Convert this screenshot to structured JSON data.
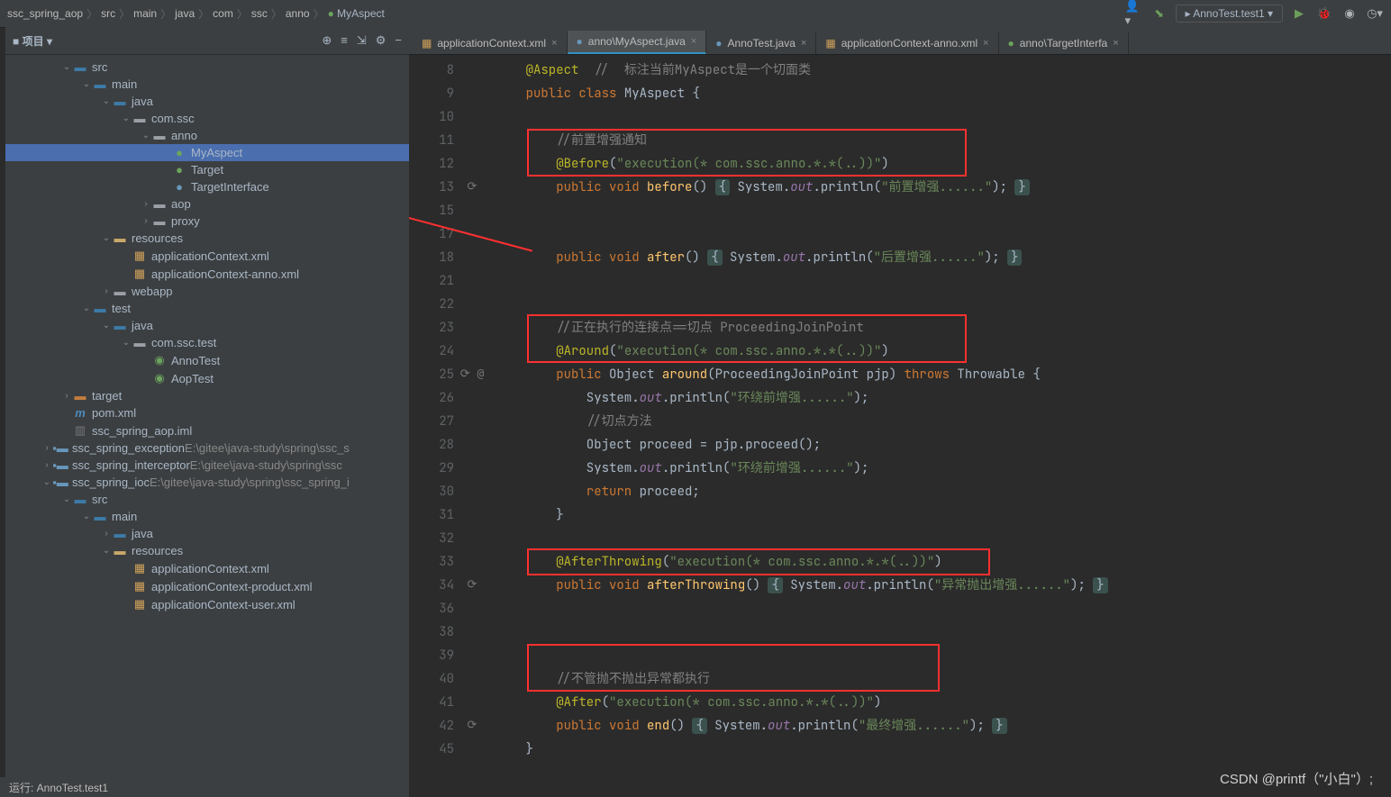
{
  "breadcrumb": [
    "ssc_spring_aop",
    "src",
    "main",
    "java",
    "com",
    "ssc",
    "anno",
    "MyAspect"
  ],
  "run_config": "AnnoTest.test1",
  "project": {
    "title": "项目"
  },
  "tree": [
    {
      "d": 0,
      "a": "v",
      "i": "fs",
      "t": "src"
    },
    {
      "d": 1,
      "a": "v",
      "i": "fs",
      "t": "main"
    },
    {
      "d": 2,
      "a": "v",
      "i": "fs",
      "t": "java"
    },
    {
      "d": 3,
      "a": "v",
      "i": "fp",
      "t": "com.ssc"
    },
    {
      "d": 4,
      "a": "v",
      "i": "fp",
      "t": "anno"
    },
    {
      "d": 5,
      "a": "",
      "i": "c",
      "t": "MyAspect",
      "sel": true
    },
    {
      "d": 5,
      "a": "",
      "i": "c",
      "t": "Target"
    },
    {
      "d": 5,
      "a": "",
      "i": "if",
      "t": "TargetInterface"
    },
    {
      "d": 4,
      "a": ">",
      "i": "fp",
      "t": "aop"
    },
    {
      "d": 4,
      "a": ">",
      "i": "fp",
      "t": "proxy"
    },
    {
      "d": 2,
      "a": "v",
      "i": "fr",
      "t": "resources"
    },
    {
      "d": 3,
      "a": "",
      "i": "x",
      "t": "applicationContext.xml"
    },
    {
      "d": 3,
      "a": "",
      "i": "x",
      "t": "applicationContext-anno.xml"
    },
    {
      "d": 2,
      "a": ">",
      "i": "fw",
      "t": "webapp"
    },
    {
      "d": 1,
      "a": "v",
      "i": "fs",
      "t": "test"
    },
    {
      "d": 2,
      "a": "v",
      "i": "fs",
      "t": "java"
    },
    {
      "d": 3,
      "a": "v",
      "i": "fp",
      "t": "com.ssc.test"
    },
    {
      "d": 4,
      "a": "",
      "i": "ct",
      "t": "AnnoTest"
    },
    {
      "d": 4,
      "a": "",
      "i": "ct",
      "t": "AopTest"
    },
    {
      "d": 0,
      "a": ">",
      "i": "ft",
      "t": "target"
    },
    {
      "d": 0,
      "a": "",
      "i": "m",
      "t": "pom.xml"
    },
    {
      "d": 0,
      "a": "",
      "i": "iml",
      "t": "ssc_spring_aop.iml"
    },
    {
      "d": -1,
      "a": ">",
      "i": "mod",
      "t": "ssc_spring_exception",
      "dim": "E:\\gitee\\java-study\\spring\\ssc_s"
    },
    {
      "d": -1,
      "a": ">",
      "i": "mod",
      "t": "ssc_spring_interceptor",
      "dim": "E:\\gitee\\java-study\\spring\\ssc"
    },
    {
      "d": -1,
      "a": "v",
      "i": "mod",
      "t": "ssc_spring_ioc",
      "dim": "E:\\gitee\\java-study\\spring\\ssc_spring_i"
    },
    {
      "d": 0,
      "a": "v",
      "i": "fs",
      "t": "src"
    },
    {
      "d": 1,
      "a": "v",
      "i": "fs",
      "t": "main"
    },
    {
      "d": 2,
      "a": ">",
      "i": "fs",
      "t": "java"
    },
    {
      "d": 2,
      "a": "v",
      "i": "fr",
      "t": "resources"
    },
    {
      "d": 3,
      "a": "",
      "i": "x",
      "t": "applicationContext.xml"
    },
    {
      "d": 3,
      "a": "",
      "i": "x",
      "t": "applicationContext-product.xml"
    },
    {
      "d": 3,
      "a": "",
      "i": "x",
      "t": "applicationContext-user.xml"
    }
  ],
  "tabs": [
    {
      "label": "applicationContext.xml",
      "icon": "x"
    },
    {
      "label": "anno\\MyAspect.java",
      "icon": "c",
      "active": true
    },
    {
      "label": "AnnoTest.java",
      "icon": "c"
    },
    {
      "label": "applicationContext-anno.xml",
      "icon": "x"
    },
    {
      "label": "anno\\TargetInterfa",
      "icon": "if"
    }
  ],
  "code": {
    "lines": [
      8,
      9,
      10,
      11,
      12,
      13,
      15,
      17,
      18,
      21,
      22,
      23,
      24,
      25,
      26,
      27,
      28,
      29,
      30,
      31,
      32,
      33,
      34,
      36,
      38,
      39,
      40,
      41,
      42,
      45
    ],
    "gutter_icons": {
      "13": "⟳",
      "25": "⟳  @",
      "34": "⟳",
      "42": "⟳"
    }
  },
  "c": {
    "aspect": "@Aspect",
    "aspect_c": "  //  标注当前MyAspect是一个切面类",
    "public": "public",
    "class": "class",
    "myaspect": "MyAspect",
    "ob": "{",
    "c_before": "//前置增强通知",
    "before_a": "@Before",
    "before_v": "\"execution(* com.ssc.anno.*.*(..))\"",
    "v": "void",
    "m_before": "before",
    "out": "out",
    "pl": "println",
    "s_before": "\"前置增强......\"",
    "fold": "{",
    "fold2": "}",
    "m_after": "after",
    "s_after": "\"后置增强......\"",
    "c_around": "//正在执行的连接点==切点 ProceedingJoinPoint",
    "around_a": "@Around",
    "around_v": "\"execution(* com.ssc.anno.*.*(..))\"",
    "obj": "Object",
    "m_around": "around",
    "pjp": "ProceedingJoinPoint pjp",
    "throws": "throws",
    "throwable": "Throwable",
    "s_around1": "\"环绕前增强......\"",
    "c_cut": "//切点方法",
    "proceed": "Object proceed = pjp.proceed();",
    "s_around2": "\"环绕前增强......\"",
    "ret": "return",
    "retv": "proceed;",
    "at_a": "@AfterThrowing",
    "at_v": "\"execution(* com.ssc.anno.*.*(..))\"",
    "m_at": "afterThrowing",
    "s_at": "\"异常抛出增强......\"",
    "c_end": "//不管抛不抛出异常都执行",
    "after_a": "@After",
    "after_v": "\"execution(* com.ssc.anno.*.*(..))\"",
    "m_end": "end",
    "s_end": "\"最终增强......\"",
    "sys": "System"
  },
  "status": "运行:    AnnoTest.test1",
  "watermark": "CSDN @printf（\"小白\"）;"
}
